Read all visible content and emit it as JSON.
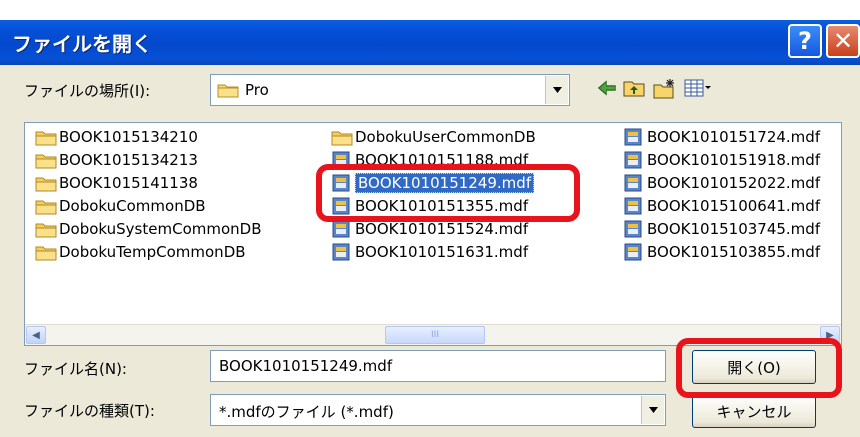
{
  "window": {
    "title": "ファイルを開く",
    "help_glyph": "?",
    "close_glyph": "✕"
  },
  "location": {
    "label": "ファイルの場所(I):",
    "value": "Pro"
  },
  "toolbar": {
    "icons": [
      "back-icon",
      "up-folder-icon",
      "new-folder-icon",
      "view-menu-icon"
    ]
  },
  "files": {
    "column1": [
      {
        "name": "BOOK1015134210",
        "type": "folder"
      },
      {
        "name": "BOOK1015134213",
        "type": "folder"
      },
      {
        "name": "BOOK1015141138",
        "type": "folder"
      },
      {
        "name": "DobokuCommonDB",
        "type": "folder"
      },
      {
        "name": "DobokuSystemCommonDB",
        "type": "folder"
      },
      {
        "name": "DobokuTempCommonDB",
        "type": "folder"
      }
    ],
    "column2": [
      {
        "name": "DobokuUserCommonDB",
        "type": "folder"
      },
      {
        "name": "BOOK1010151188.mdf",
        "type": "mdf"
      },
      {
        "name": "BOOK1010151249.mdf",
        "type": "mdf",
        "selected": true
      },
      {
        "name": "BOOK1010151355.mdf",
        "type": "mdf"
      },
      {
        "name": "BOOK1010151524.mdf",
        "type": "mdf"
      },
      {
        "name": "BOOK1010151631.mdf",
        "type": "mdf"
      }
    ],
    "column3": [
      {
        "name": "BOOK1010151724.mdf",
        "type": "mdf"
      },
      {
        "name": "BOOK1010151918.mdf",
        "type": "mdf"
      },
      {
        "name": "BOOK1010152022.mdf",
        "type": "mdf"
      },
      {
        "name": "BOOK1015100641.mdf",
        "type": "mdf"
      },
      {
        "name": "BOOK1015103745.mdf",
        "type": "mdf"
      },
      {
        "name": "BOOK1015103855.mdf",
        "type": "mdf"
      }
    ]
  },
  "filename": {
    "label": "ファイル名(N):",
    "value": "BOOK1010151249.mdf"
  },
  "filetype": {
    "label": "ファイルの種類(T):",
    "value": "*.mdfのファイル (*.mdf)"
  },
  "buttons": {
    "open": "開く(O)",
    "cancel": "キャンセル"
  },
  "scroll": {
    "left": "◀",
    "right": "▶",
    "grip": "III"
  }
}
